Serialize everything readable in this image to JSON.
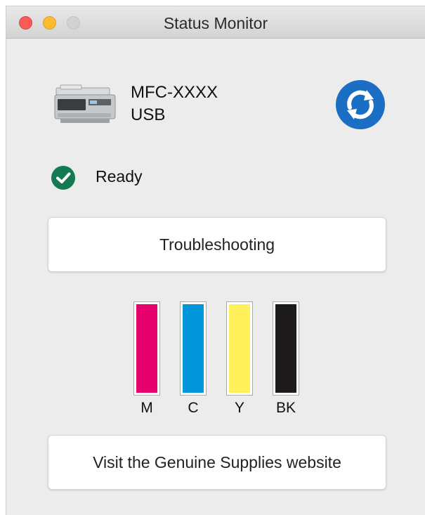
{
  "window": {
    "title": "Status Monitor"
  },
  "device": {
    "name": "MFC-XXXX",
    "connection": "USB"
  },
  "status": {
    "text": "Ready"
  },
  "buttons": {
    "troubleshooting": "Troubleshooting",
    "supplies": "Visit the Genuine Supplies website"
  },
  "inks": [
    {
      "label": "M",
      "color": "#e6006d",
      "level": 1.0
    },
    {
      "label": "C",
      "color": "#0096d9",
      "level": 1.0
    },
    {
      "label": "Y",
      "color": "#fff05a",
      "level": 1.0
    },
    {
      "label": "BK",
      "color": "#1c1a1b",
      "level": 1.0
    }
  ],
  "colors": {
    "refresh": "#1a6fc4",
    "ready": "#137a52"
  },
  "icons": {
    "refresh": "refresh-icon",
    "status": "check-circle-icon",
    "printer": "printer-icon"
  }
}
